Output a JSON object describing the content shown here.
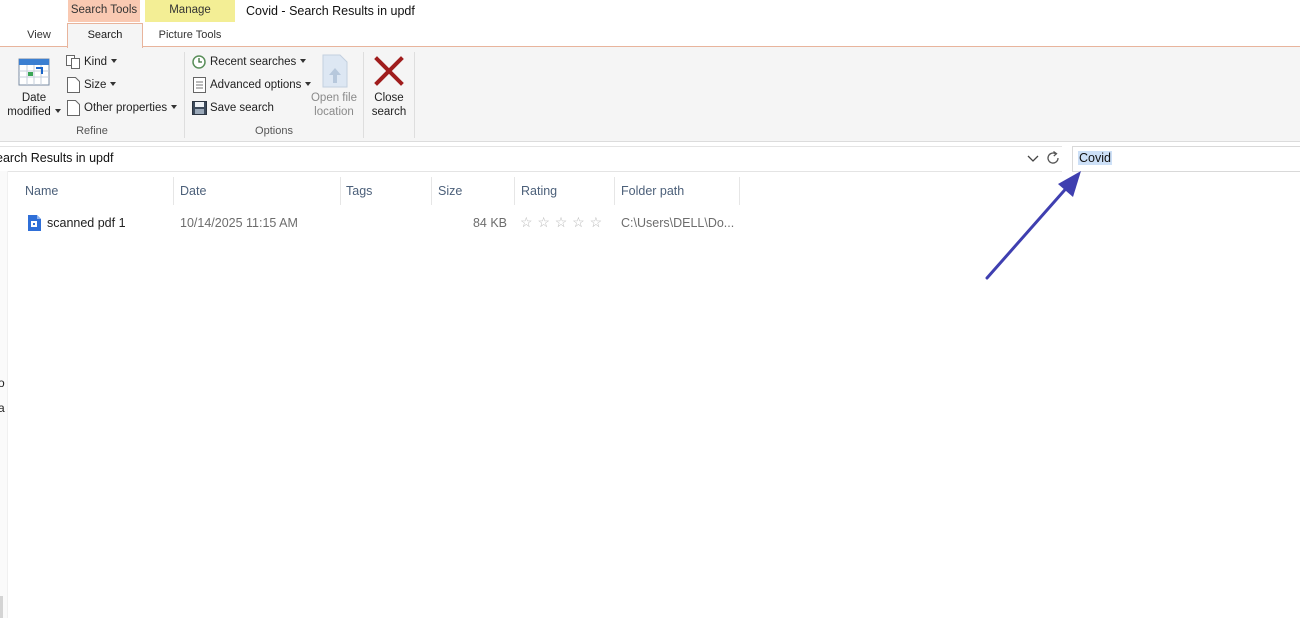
{
  "window": {
    "title": "Covid - Search Results in updf"
  },
  "context_tabs": {
    "search_tools": "Search Tools",
    "manage": "Manage"
  },
  "ribbon_tabs": {
    "view": "View",
    "search": "Search",
    "picture_tools": "Picture Tools"
  },
  "refine": {
    "date_modified_line1": "Date",
    "date_modified_line2": "modified",
    "kind": "Kind",
    "size": "Size",
    "other_properties": "Other properties",
    "group_label": "Refine"
  },
  "options": {
    "recent_searches": "Recent searches",
    "advanced_options": "Advanced options",
    "save_search": "Save search",
    "open_file_location_line1": "Open file",
    "open_file_location_line2": "location",
    "close_search_line1": "Close",
    "close_search_line2": "search",
    "group_label": "Options"
  },
  "address_bar": {
    "path_text": "earch Results in updf"
  },
  "search_box": {
    "value": "Covid"
  },
  "left_pane": {
    "stray_chars": [
      "o",
      "a"
    ]
  },
  "columns": {
    "name": "Name",
    "date": "Date",
    "tags": "Tags",
    "size": "Size",
    "rating": "Rating",
    "folder_path": "Folder path"
  },
  "files": [
    {
      "name": "scanned pdf 1",
      "date": "10/14/2025 11:15 AM",
      "tags": "",
      "size": "84 KB",
      "rating_stars": 0,
      "rating_max": 5,
      "folder_path": "C:\\Users\\DELL\\Do..."
    }
  ],
  "icons": {
    "date_modified": "calendar-icon",
    "kind": "kind-icon",
    "size": "size-icon",
    "other_properties": "properties-icon",
    "recent_searches": "recent-searches-icon",
    "advanced_options": "advanced-options-icon",
    "save_search": "save-icon",
    "open_file_location": "open-location-icon",
    "close_search": "close-icon",
    "refresh": "refresh-icon",
    "address_dropdown": "chevron-down-icon",
    "file": "pdf-file-icon",
    "annotation": "arrow-annotation"
  },
  "colors": {
    "search_tools_tab": "#f9c9b2",
    "manage_tab": "#f3ee95",
    "column_header_text": "#4c607a",
    "selection_highlight": "#cde0f7",
    "close_x": "#a01d1d",
    "annotation_arrow": "#3f3fb0"
  }
}
